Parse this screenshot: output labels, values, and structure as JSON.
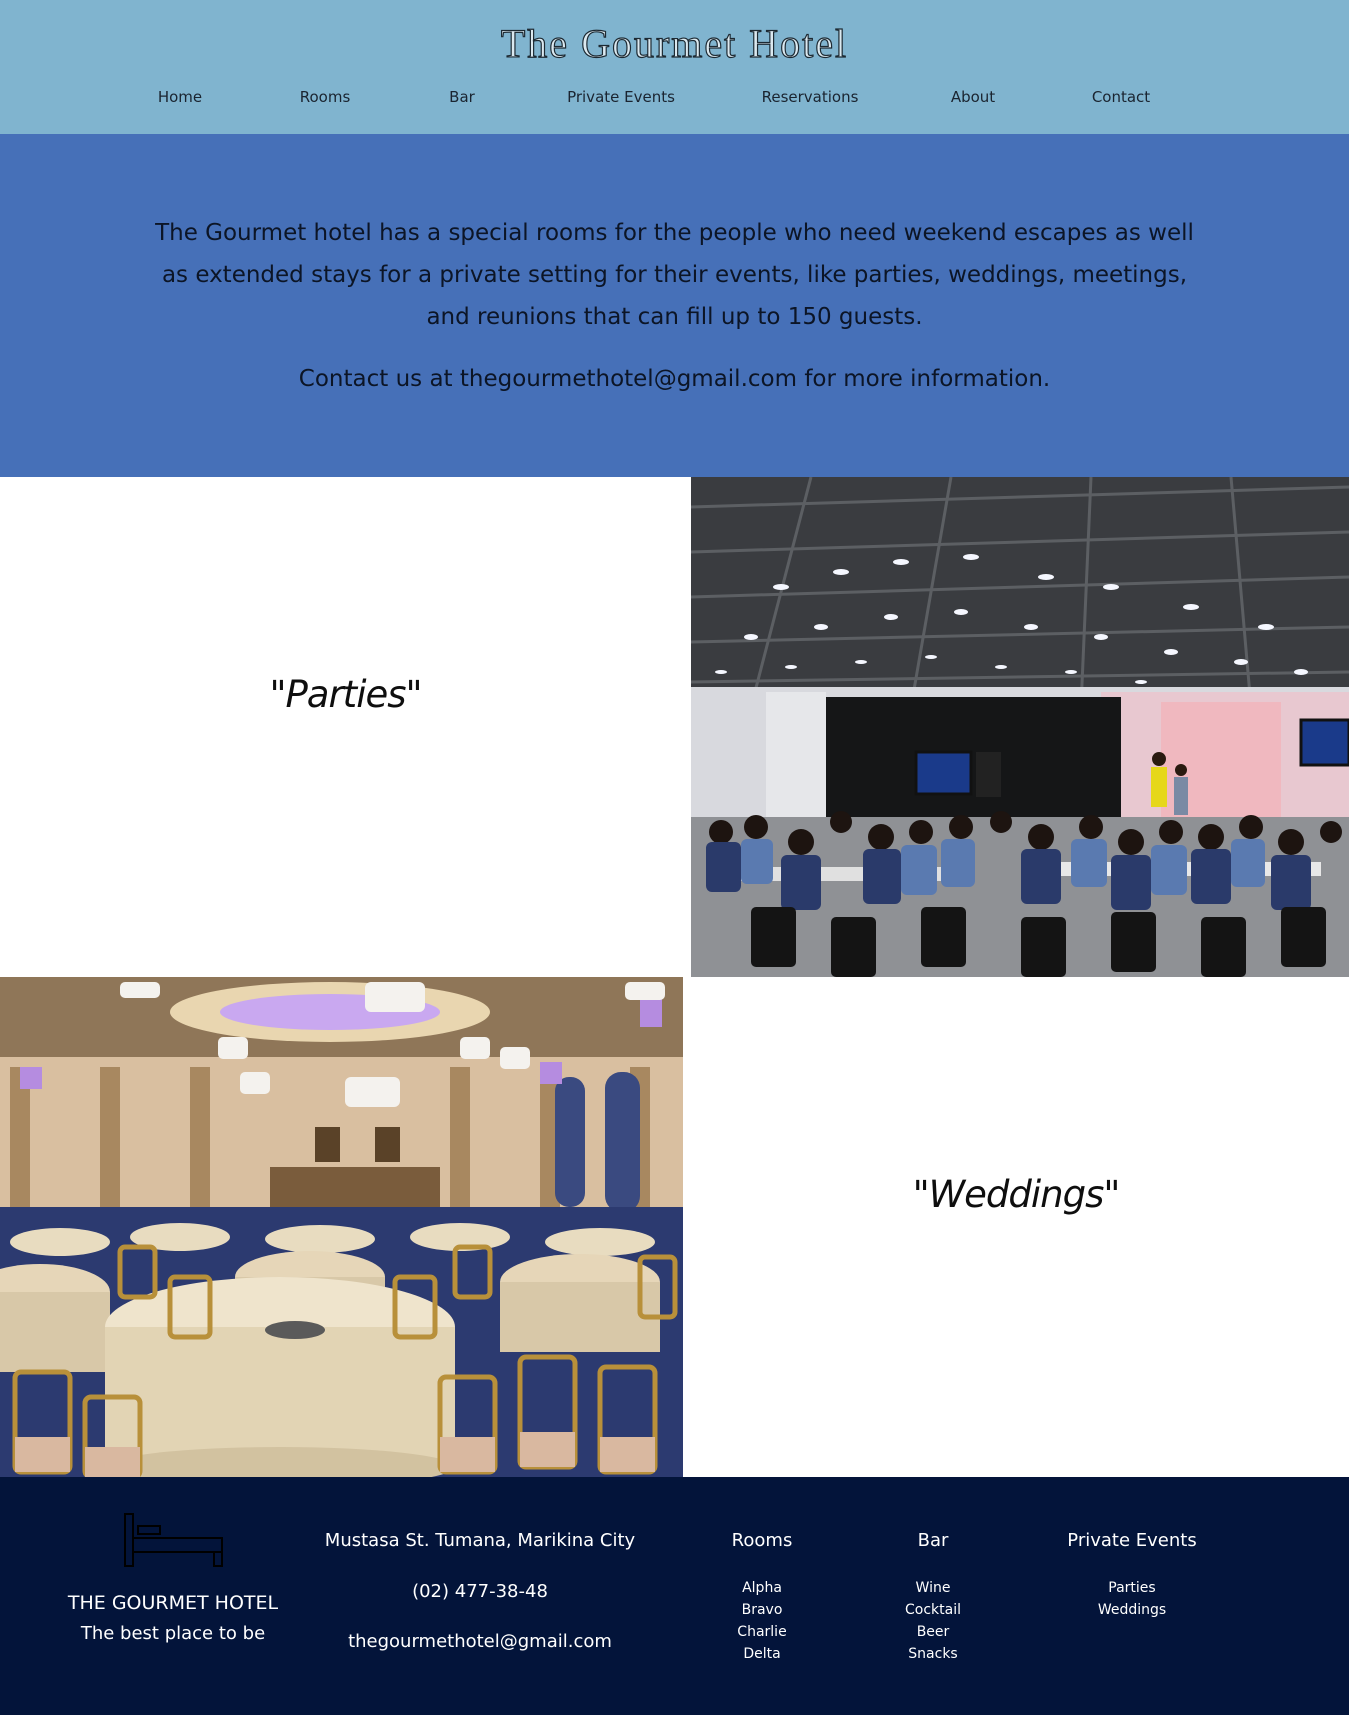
{
  "header": {
    "title": "The Gourmet Hotel",
    "nav": [
      "Home",
      "Rooms",
      "Bar",
      "Private Events",
      "Reservations",
      "About",
      "Contact"
    ]
  },
  "intro": {
    "paragraph": "The Gourmet hotel has a special rooms for the people who need weekend escapes as well as extended stays for a private setting for their events, like parties, weddings, meetings, and reunions that can fill up to 150 guests.",
    "contact": "Contact us at thegourmethotel@gmail.com for more information."
  },
  "events": {
    "parties_label": "\"Parties\"",
    "weddings_label": "\"Weddings\""
  },
  "footer": {
    "brand": "THE GOURMET HOTEL",
    "tagline": "The best place to be",
    "address": "Mustasa St. Tumana, Marikina City",
    "phone": "(02) 477-38-48",
    "email": "thegourmethotel@gmail.com",
    "columns": [
      {
        "heading": "Rooms",
        "items": [
          "Alpha",
          "Bravo",
          "Charlie",
          "Delta"
        ]
      },
      {
        "heading": "Bar",
        "items": [
          "Wine",
          "Cocktail",
          "Beer",
          "Snacks"
        ]
      },
      {
        "heading": "Private Events",
        "items": [
          "Parties",
          "Weddings"
        ]
      }
    ]
  },
  "colors": {
    "header_bg": "#80b4cf",
    "intro_bg": "#4670b8",
    "footer_bg": "#03143a"
  },
  "icons": {
    "footer_logo": "bed-icon"
  }
}
